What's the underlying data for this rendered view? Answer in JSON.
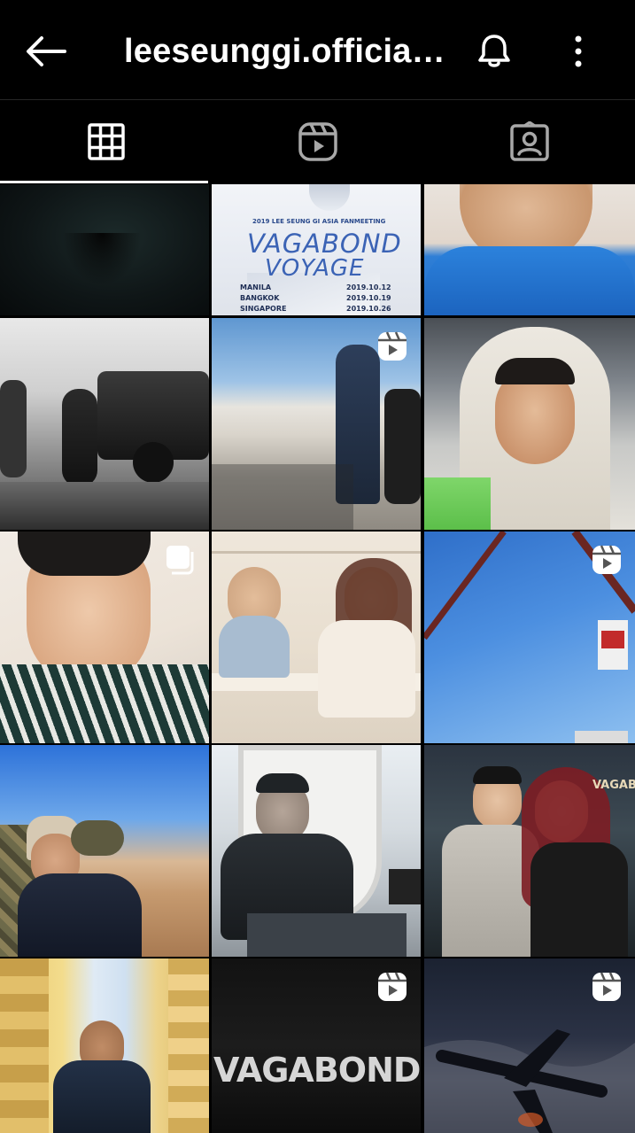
{
  "header": {
    "username": "leeseunggi.official…",
    "back_icon": "arrow-left-icon",
    "notifications_icon": "bell-icon",
    "more_icon": "more-vertical-icon"
  },
  "tabs": [
    {
      "name": "posts-grid",
      "icon": "grid-icon",
      "active": true
    },
    {
      "name": "reels",
      "icon": "reels-icon",
      "active": false
    },
    {
      "name": "tagged",
      "icon": "tagged-icon",
      "active": false
    }
  ],
  "posters": {
    "fanmeeting_line1": "2019 LEE SEUNG GI ASIA FANMEETING",
    "fanmeeting_line2": "VAGABOND",
    "fanmeeting_line3": "VOYAGE",
    "city1": "MANILA",
    "date1": "2019.10.12",
    "city2": "BANGKOK",
    "date2": "2019.10.19",
    "city3": "SINGAPORE",
    "date3": "2019.10.26",
    "vagabond_title": "VAGABOND",
    "press_wall": "VAGABO"
  },
  "posts": [
    {
      "id": "post-1",
      "badge": null
    },
    {
      "id": "post-2",
      "badge": null
    },
    {
      "id": "post-3",
      "badge": null
    },
    {
      "id": "post-4",
      "badge": null
    },
    {
      "id": "post-5",
      "badge": "reels-icon"
    },
    {
      "id": "post-6",
      "badge": null
    },
    {
      "id": "post-7",
      "badge": "carousel-icon"
    },
    {
      "id": "post-8",
      "badge": null
    },
    {
      "id": "post-9",
      "badge": "reels-icon"
    },
    {
      "id": "post-10",
      "badge": null
    },
    {
      "id": "post-11",
      "badge": null
    },
    {
      "id": "post-12",
      "badge": null
    },
    {
      "id": "post-13",
      "badge": null
    },
    {
      "id": "post-14",
      "badge": "reels-icon"
    },
    {
      "id": "post-15",
      "badge": "reels-icon"
    }
  ]
}
